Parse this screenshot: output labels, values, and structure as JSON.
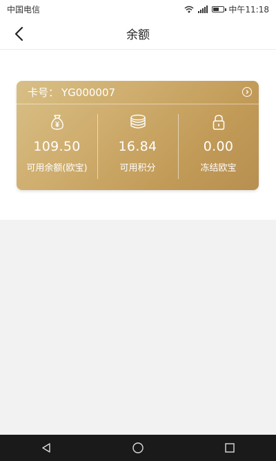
{
  "status_bar": {
    "carrier": "中国电信",
    "time": "中午11:18"
  },
  "header": {
    "title": "余额",
    "back_icon": "chevron-left-icon"
  },
  "card": {
    "card_number_label": "卡号：",
    "card_number": "YG000007",
    "detail_icon": "chevron-right-circle-icon",
    "colors": {
      "gradient_start": "#d8bf86",
      "gradient_end": "#b78f50",
      "text": "#ffffff"
    },
    "columns": [
      {
        "icon": "money-bag-icon",
        "value": "109.50",
        "label": "可用余额(欧宝)"
      },
      {
        "icon": "coins-icon",
        "value": "16.84",
        "label": "可用积分"
      },
      {
        "icon": "lock-icon",
        "value": "0.00",
        "label": "冻结欧宝"
      }
    ]
  },
  "nav_bar": {
    "buttons": [
      "back-triangle-icon",
      "home-circle-icon",
      "recents-square-icon"
    ]
  }
}
